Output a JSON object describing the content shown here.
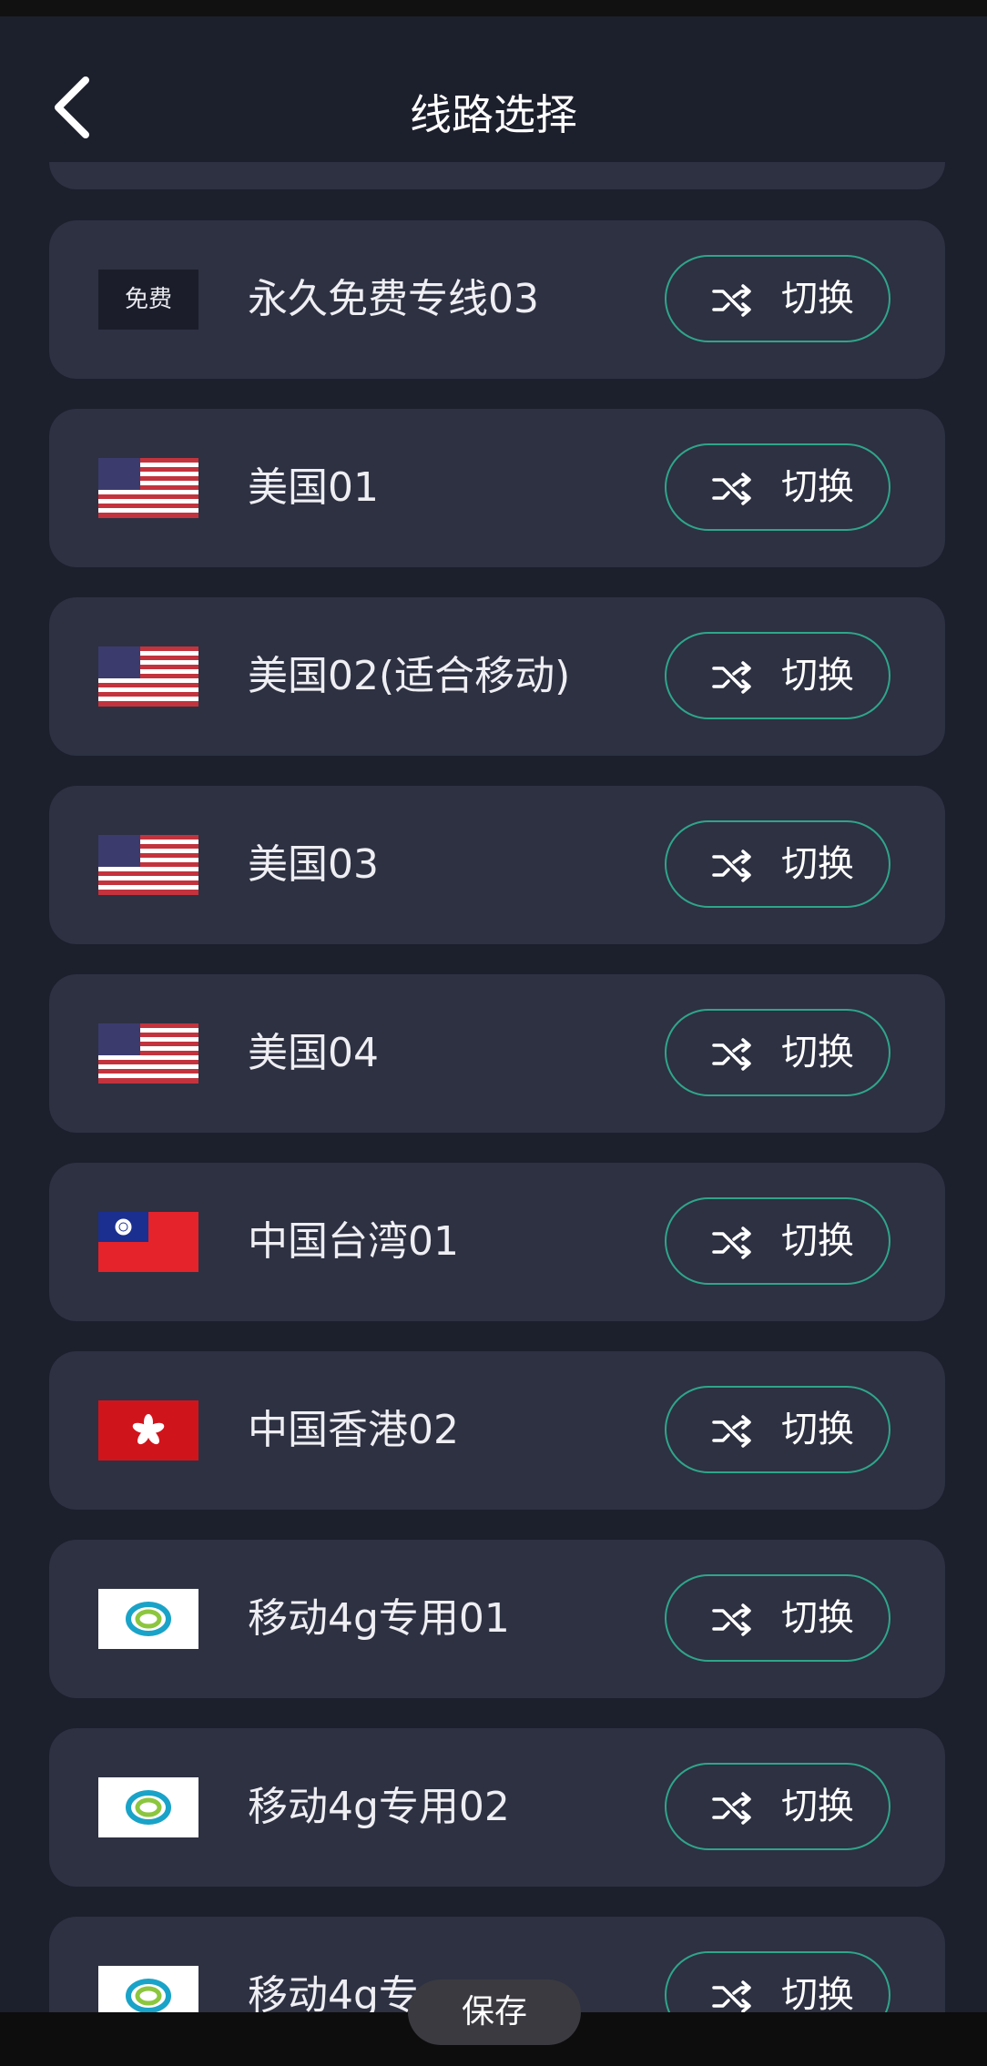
{
  "header": {
    "title": "线路选择"
  },
  "colors": {
    "background": "#1c1f2c",
    "card": "#2d3142",
    "accent": "#2fa58a"
  },
  "routes": [
    {
      "name": "永久免费专线03",
      "icon": "free-badge",
      "badge": "免费",
      "button_label": "切换",
      "button_icon": "shuffle-icon"
    },
    {
      "name": "美国01",
      "icon": "us-flag-icon",
      "button_label": "切换",
      "button_icon": "shuffle-icon"
    },
    {
      "name": "美国02(适合移动)",
      "icon": "us-flag-icon",
      "button_label": "切换",
      "button_icon": "shuffle-icon"
    },
    {
      "name": "美国03",
      "icon": "us-flag-icon",
      "button_label": "切换",
      "button_icon": "shuffle-icon"
    },
    {
      "name": "美国04",
      "icon": "us-flag-icon",
      "button_label": "切换",
      "button_icon": "shuffle-icon"
    },
    {
      "name": "中国台湾01",
      "icon": "tw-flag-icon",
      "button_label": "切换",
      "button_icon": "shuffle-icon"
    },
    {
      "name": "中国香港02",
      "icon": "hk-flag-icon",
      "button_label": "切换",
      "button_icon": "shuffle-icon"
    },
    {
      "name": "移动4g专用01",
      "icon": "china-mobile-logo-icon",
      "button_label": "切换",
      "button_icon": "shuffle-icon"
    },
    {
      "name": "移动4g专用02",
      "icon": "china-mobile-logo-icon",
      "button_label": "切换",
      "button_icon": "shuffle-icon"
    },
    {
      "name": "移动4g专",
      "icon": "china-mobile-logo-icon",
      "button_label": "切换",
      "button_icon": "shuffle-icon"
    }
  ],
  "footer": {
    "save_label": "保存"
  }
}
